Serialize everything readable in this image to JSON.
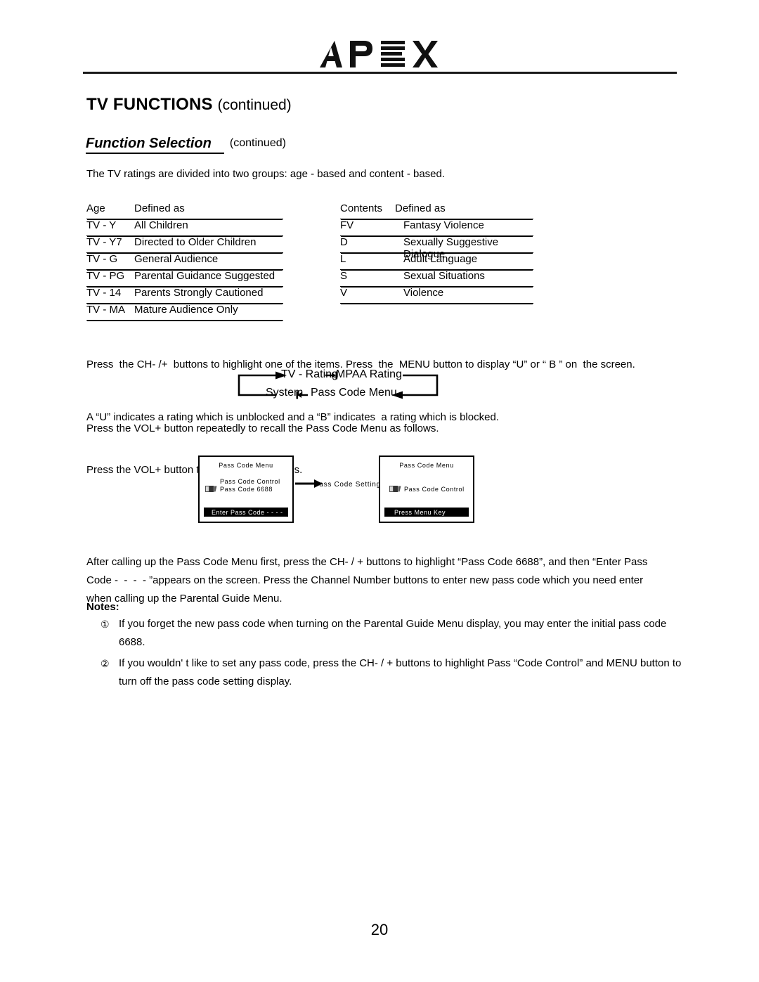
{
  "brand": {
    "logo_text": "APEX"
  },
  "header": {
    "title": "TV FUNCTIONS",
    "title_continued": "(continued)",
    "subtitle": "Function Selection",
    "subtitle_continued": "(continued)"
  },
  "intro": "The TV ratings are divided into two groups: age - based and content - based.",
  "age_table": {
    "headers": [
      "Age",
      "Defined as"
    ],
    "rows": [
      [
        "TV - Y",
        "All Children"
      ],
      [
        "TV - Y7",
        "Directed to Older Children"
      ],
      [
        "TV - G",
        "General Audience"
      ],
      [
        "TV - PG",
        "Parental Guidance Suggested"
      ],
      [
        "TV - 14",
        "Parents Strongly Cautioned"
      ],
      [
        "TV - MA",
        "Mature Audience Only"
      ]
    ]
  },
  "contents_table": {
    "headers": [
      "Contents",
      "Defined as"
    ],
    "rows": [
      [
        "FV",
        "Fantasy Violence"
      ],
      [
        "D",
        "Sexually Suggestive Dialogue"
      ],
      [
        "L",
        "Adult Language"
      ],
      [
        "S",
        "Sexual Situations"
      ],
      [
        "V",
        "Violence"
      ]
    ]
  },
  "instructions": {
    "line1": "Press  the CH- /+  buttons to highlight one of the items. Press  the  MENU button to display “U” or “ B ” on  the screen.",
    "line2": "A “U” indicates a rating which is unblocked and a “B” indicates  a rating which is blocked.",
    "line3": "Press the VOL+ button to cycle the selections."
  },
  "cycle_diagram": {
    "tv_rating": "TV - Rating",
    "mpaa_rating": "MPAA  Rating",
    "system": "System",
    "pass_code_menu": "Pass Code Menu"
  },
  "recall_text": "Press the VOL+ button repeatedly to recall the Pass Code Menu as follows.",
  "osd_left": {
    "title": "Pass  Code  Menu",
    "line1": "Pass  Code  Control",
    "line2": "Pass  Code  6688",
    "status_bar": "Enter Pass Code  -  -  -  -",
    "cursor_icon": "cursor-icon"
  },
  "osd_arrow_label": "Pass  Code  Setting",
  "osd_right": {
    "title": "Pass  Code  Menu",
    "line1": "Pass  Code  Control",
    "status_bar": "Press Menu Key",
    "cursor_icon": "cursor-icon"
  },
  "after_text": "After calling up the Pass Code Menu first, press the CH- / + buttons to highlight “Pass Code 6688”, and then “Enter Pass\nCode -  -  -  - ”appears on the screen. Press the Channel Number buttons to enter new pass code which you need enter\nwhen calling up the Parental Guide Menu.",
  "notes": {
    "label": "Notes:",
    "items": [
      {
        "number": "①",
        "text": "If you forget the new pass code when turning on the Parental Guide Menu display, you may enter the initial pass code 6688."
      },
      {
        "number": "②",
        "text": "If you wouldn' t like to set any pass code, press the CH- / +  buttons to highlight Pass “Code Control” and MENU button to turn off the pass code setting display."
      }
    ]
  },
  "page_number": "20"
}
